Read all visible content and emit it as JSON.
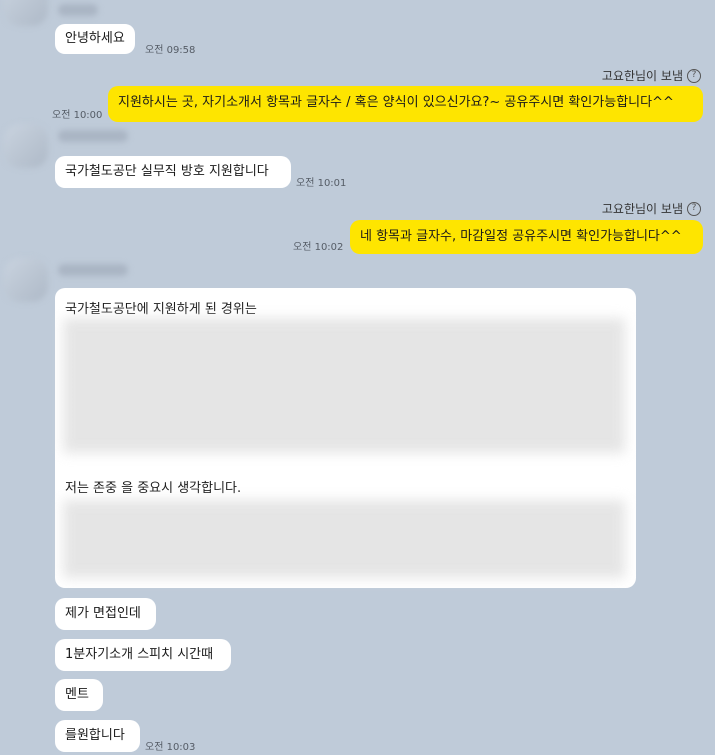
{
  "messages": {
    "m1": {
      "text": "안녕하세요",
      "time": "오전 09:58"
    },
    "m2": {
      "sender": "고요한님이 보냄",
      "text": "지원하시는 곳, 자기소개서 항목과 글자수 / 혹은 양식이 있으신가요?~ 공유주시면 확인가능합니다^^",
      "time": "오전 10:00"
    },
    "m3": {
      "text": "국가철도공단 실무직 방호 지원합니다",
      "time": "오전 10:01"
    },
    "m4": {
      "sender": "고요한님이 보냄",
      "text": "네 항목과 글자수, 마감일정 공유주시면 확인가능합니다^^",
      "time": "오전 10:02"
    },
    "m5": {
      "line1": "국가철도공단에 지원하게 된 경위는",
      "line2": "저는 존중 을 중요시 생각합니다."
    },
    "m6": {
      "text": "제가 면접인데"
    },
    "m7": {
      "text": "1분자기소개 스피치 시간때"
    },
    "m8": {
      "text": "멘트"
    },
    "m9": {
      "text": "를원합니다",
      "time": "오전 10:03"
    }
  },
  "icons": {
    "help": "?"
  }
}
